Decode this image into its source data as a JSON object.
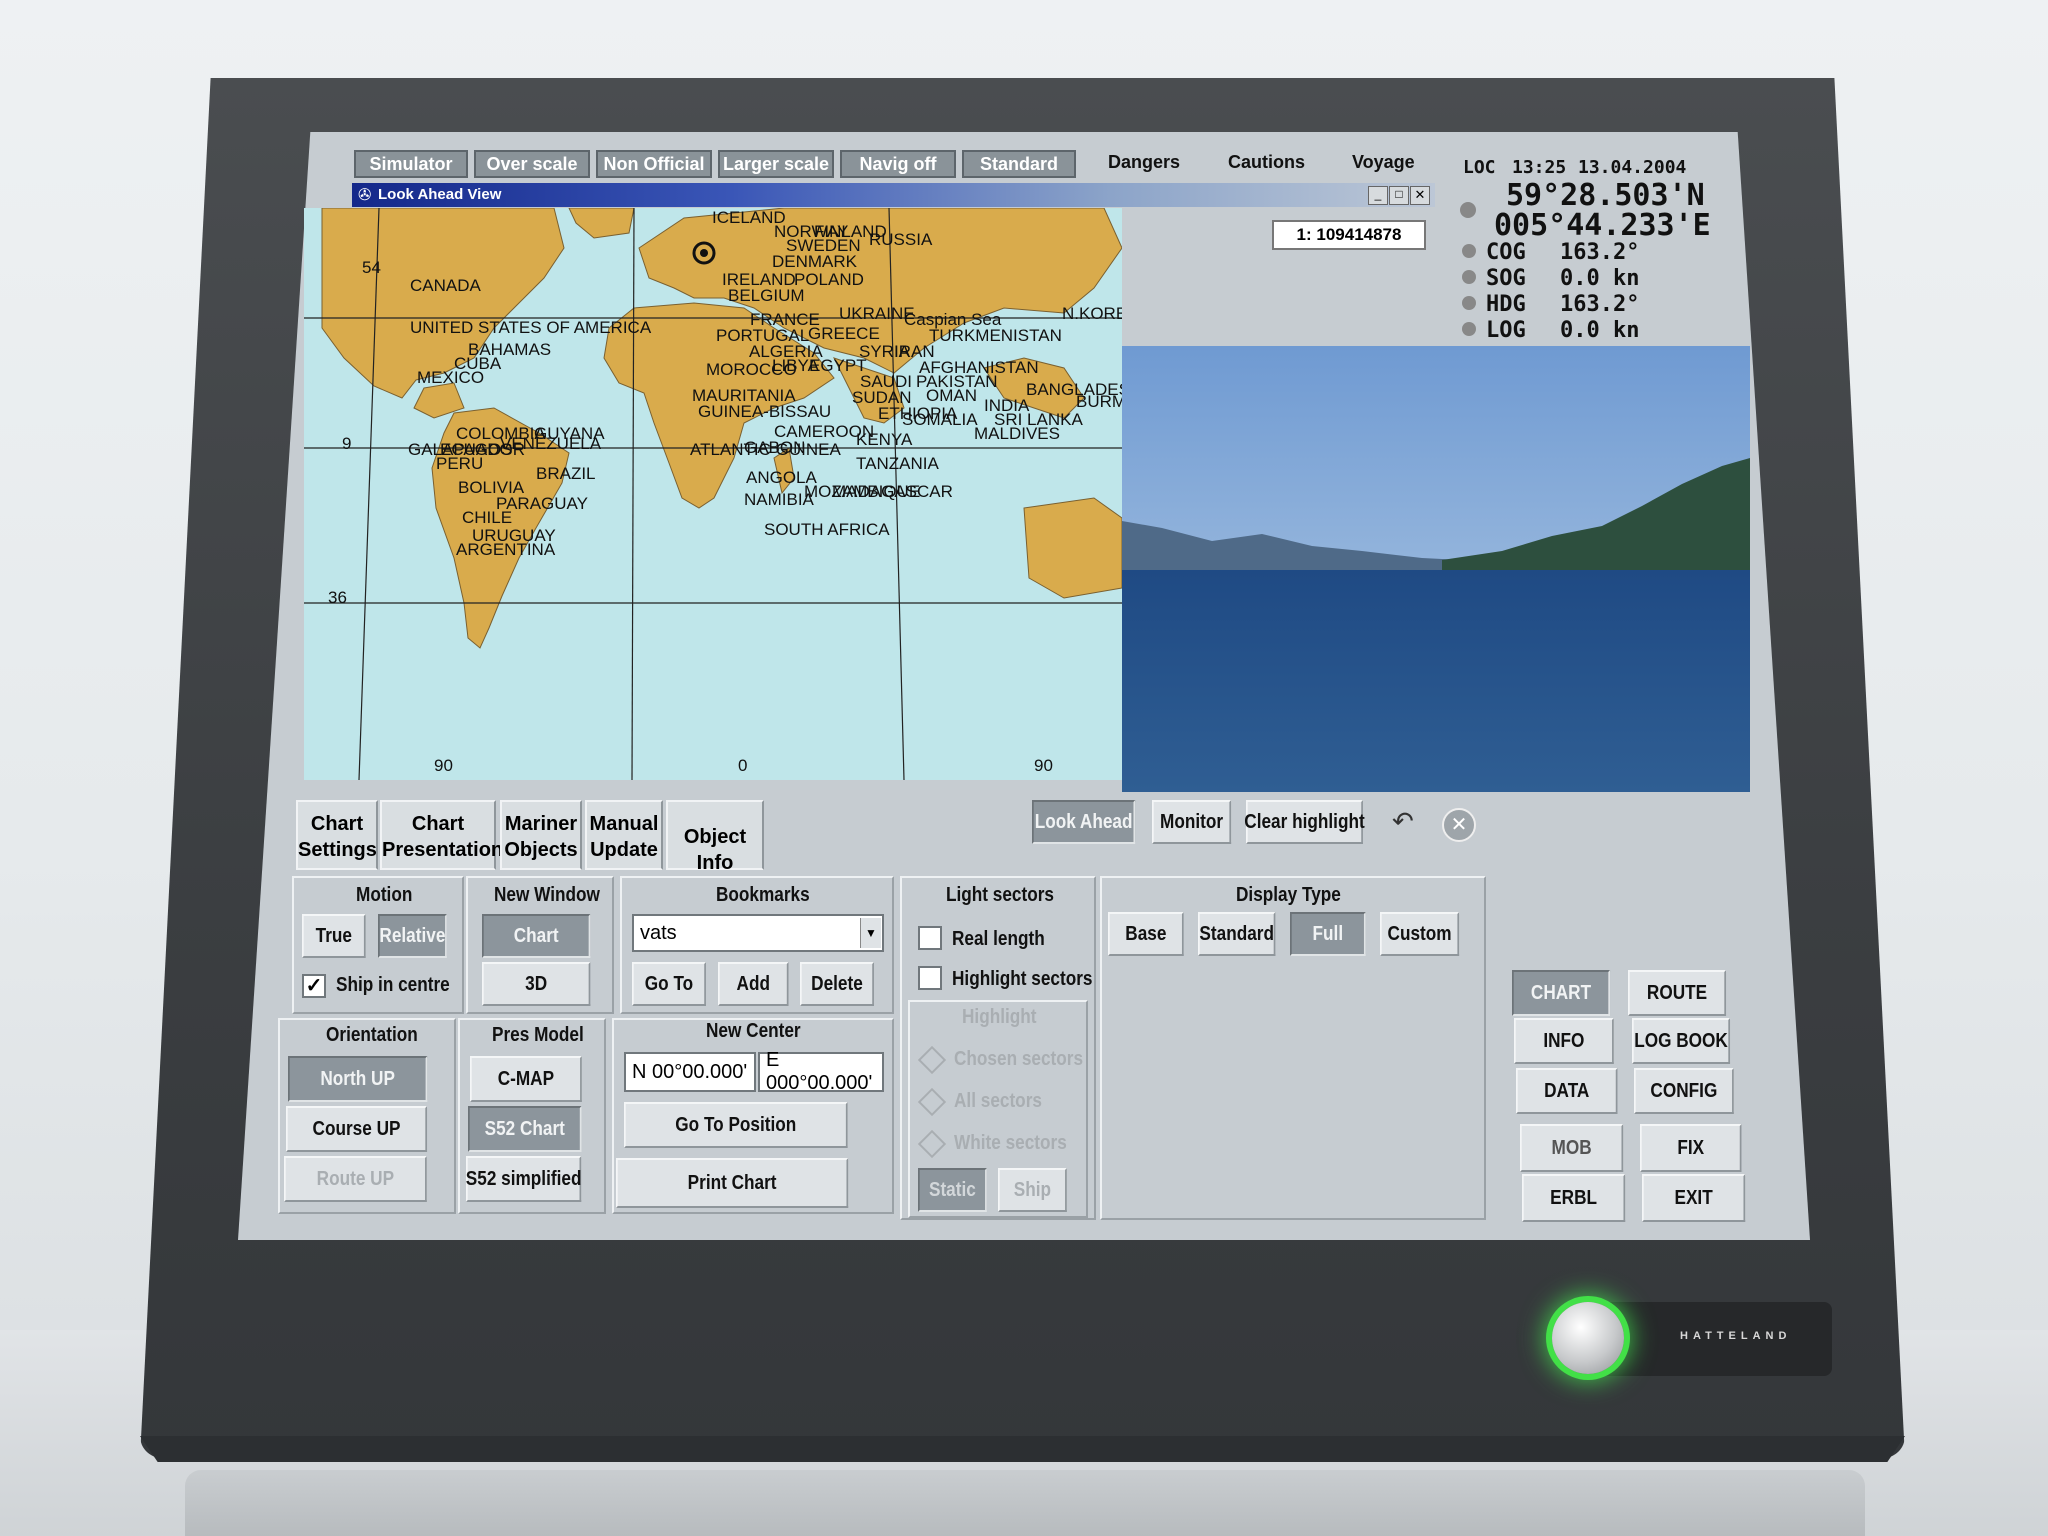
{
  "device": {
    "brand": "HATTELAND"
  },
  "top_bar": {
    "buttons": [
      "Simulator",
      "Over scale",
      "Non Official",
      "Larger scale",
      "Navig off",
      "Standard"
    ],
    "links": [
      "Dangers",
      "Cautions",
      "Voyage"
    ]
  },
  "window": {
    "title": "Look Ahead View",
    "scale": "1: 109414878"
  },
  "nav": {
    "loc_label": "LOC",
    "time": "13:25",
    "date": "13.04.2004",
    "lat": "59°28.503'N",
    "lon": "005°44.233'E",
    "rows": [
      {
        "label": "COG",
        "value": "163.2°"
      },
      {
        "label": "SOG",
        "value": "0.0 kn"
      },
      {
        "label": "HDG",
        "value": "163.2°"
      },
      {
        "label": "LOG",
        "value": "0.0 kn"
      }
    ]
  },
  "map_labels": [
    "ICELAND",
    "NORWAY",
    "FINLAND",
    "SWEDEN",
    "RUSSIA",
    "DENMARK",
    "IRELAND",
    "POLAND",
    "BELGIUM",
    "CANADA",
    "FRANCE",
    "UKRAINE",
    "Caspian Sea",
    "PORTUGAL",
    "GREECE",
    "TURKMENISTAN",
    "ALGERIA",
    "SYRIA",
    "IRAN",
    "UNITED STATES OF AMERICA",
    "MOROCCO",
    "LIBYA",
    "EGYPT",
    "AFGHANISTAN",
    "PAKISTAN",
    "SAUDI",
    "N.KOREA",
    "BANGLADESH",
    "BURMA",
    "BAHAMAS",
    "CUBA",
    "MEXICO",
    "MAURITANIA",
    "SUDAN",
    "OMAN",
    "INDIA",
    "GUINEA-BISSAU",
    "ETHIOPIA",
    "SOMALIA",
    "SRI LANKA",
    "MALDIVES",
    "COLOMBIA",
    "GUYANA",
    "CAMEROON",
    "KENYA",
    "GABON",
    "GALAPAGOS",
    "ECUADOR",
    "PERU",
    "BRAZIL",
    "ANGOLA",
    "TANZANIA",
    "BOLIVIA",
    "NAMIBIA",
    "MOZAMBIQUE",
    "MADAGASCAR",
    "PARAGUAY",
    "CHILE",
    "URUGUAY",
    "ARGENTINA",
    "SOUTH AFRICA",
    "VENEZUELA",
    "ATLANTIC GUINEA",
    "U"
  ],
  "map_ticks": [
    "54",
    "9",
    "36",
    "90",
    "0",
    "90"
  ],
  "tabs": [
    "Chart Settings",
    "Chart Presentation",
    "Mariner Objects",
    "Manual Update",
    "Object Info"
  ],
  "view_buttons": [
    "Look Ahead",
    "Monitor",
    "Clear highlight"
  ],
  "motion": {
    "title": "Motion",
    "true": "True",
    "relative": "Relative",
    "ship_centre": "Ship in centre"
  },
  "new_window": {
    "title": "New Window",
    "chart": "Chart",
    "threed": "3D"
  },
  "bookmarks": {
    "title": "Bookmarks",
    "value": "vats",
    "goto": "Go To",
    "add": "Add",
    "delete": "Delete"
  },
  "orientation": {
    "title": "Orientation",
    "north": "North UP",
    "course": "Course UP",
    "route": "Route UP"
  },
  "pres_model": {
    "title": "Pres Model",
    "cmap": "C-MAP",
    "s52": "S52 Chart",
    "s52s": "S52 simplified"
  },
  "new_center": {
    "title": "New Center",
    "lat": "N 00°00.000'",
    "lon": "E 000°00.000'",
    "goto": "Go To Position",
    "print": "Print Chart"
  },
  "light": {
    "title": "Light sectors",
    "real": "Real length",
    "highlight": "Highlight sectors",
    "hl_title": "Highlight",
    "chosen": "Chosen sectors",
    "all": "All sectors",
    "white": "White sectors",
    "static": "Static",
    "ship": "Ship"
  },
  "display_type": {
    "title": "Display Type",
    "base": "Base",
    "standard": "Standard",
    "full": "Full",
    "custom": "Custom"
  },
  "main_menu": [
    "CHART",
    "ROUTE",
    "INFO",
    "LOG BOOK",
    "DATA",
    "CONFIG",
    "MOB",
    "FIX",
    "ERBL",
    "EXIT"
  ],
  "colors": {
    "sea": "#bfe6ea",
    "land": "#d9ab4c",
    "active": "#8c959c",
    "glow": "#42e047"
  }
}
